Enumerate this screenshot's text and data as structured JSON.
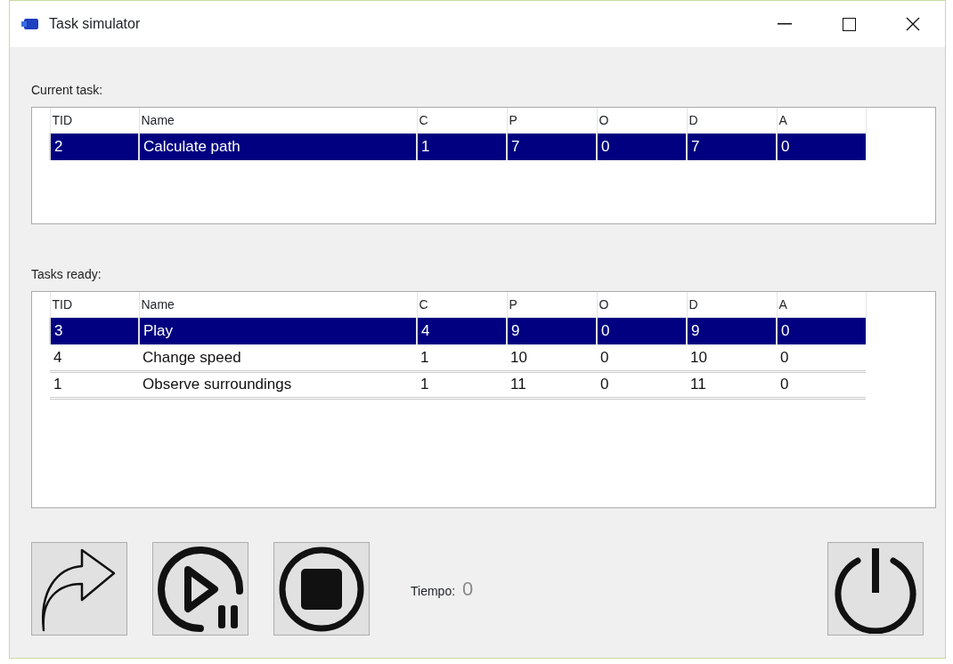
{
  "window": {
    "title": "Task simulator"
  },
  "current_task": {
    "label": "Current task:",
    "columns": [
      "TID",
      "Name",
      "C",
      "P",
      "O",
      "D",
      "A"
    ],
    "rows": [
      {
        "selected": true,
        "cells": [
          "2",
          "Calculate path",
          "1",
          "7",
          "0",
          "7",
          "0"
        ]
      }
    ]
  },
  "tasks_ready": {
    "label": "Tasks ready:",
    "columns": [
      "TID",
      "Name",
      "C",
      "P",
      "O",
      "D",
      "A"
    ],
    "rows": [
      {
        "selected": true,
        "cells": [
          "3",
          "Play",
          "4",
          "9",
          "0",
          "9",
          "0"
        ]
      },
      {
        "selected": false,
        "cells": [
          "4",
          "Change speed",
          "1",
          "10",
          "0",
          "10",
          "0"
        ]
      },
      {
        "selected": false,
        "cells": [
          "1",
          "Observe surroundings",
          "1",
          "11",
          "0",
          "11",
          "0"
        ]
      }
    ]
  },
  "time": {
    "label": "Tiempo:",
    "value": "0"
  }
}
